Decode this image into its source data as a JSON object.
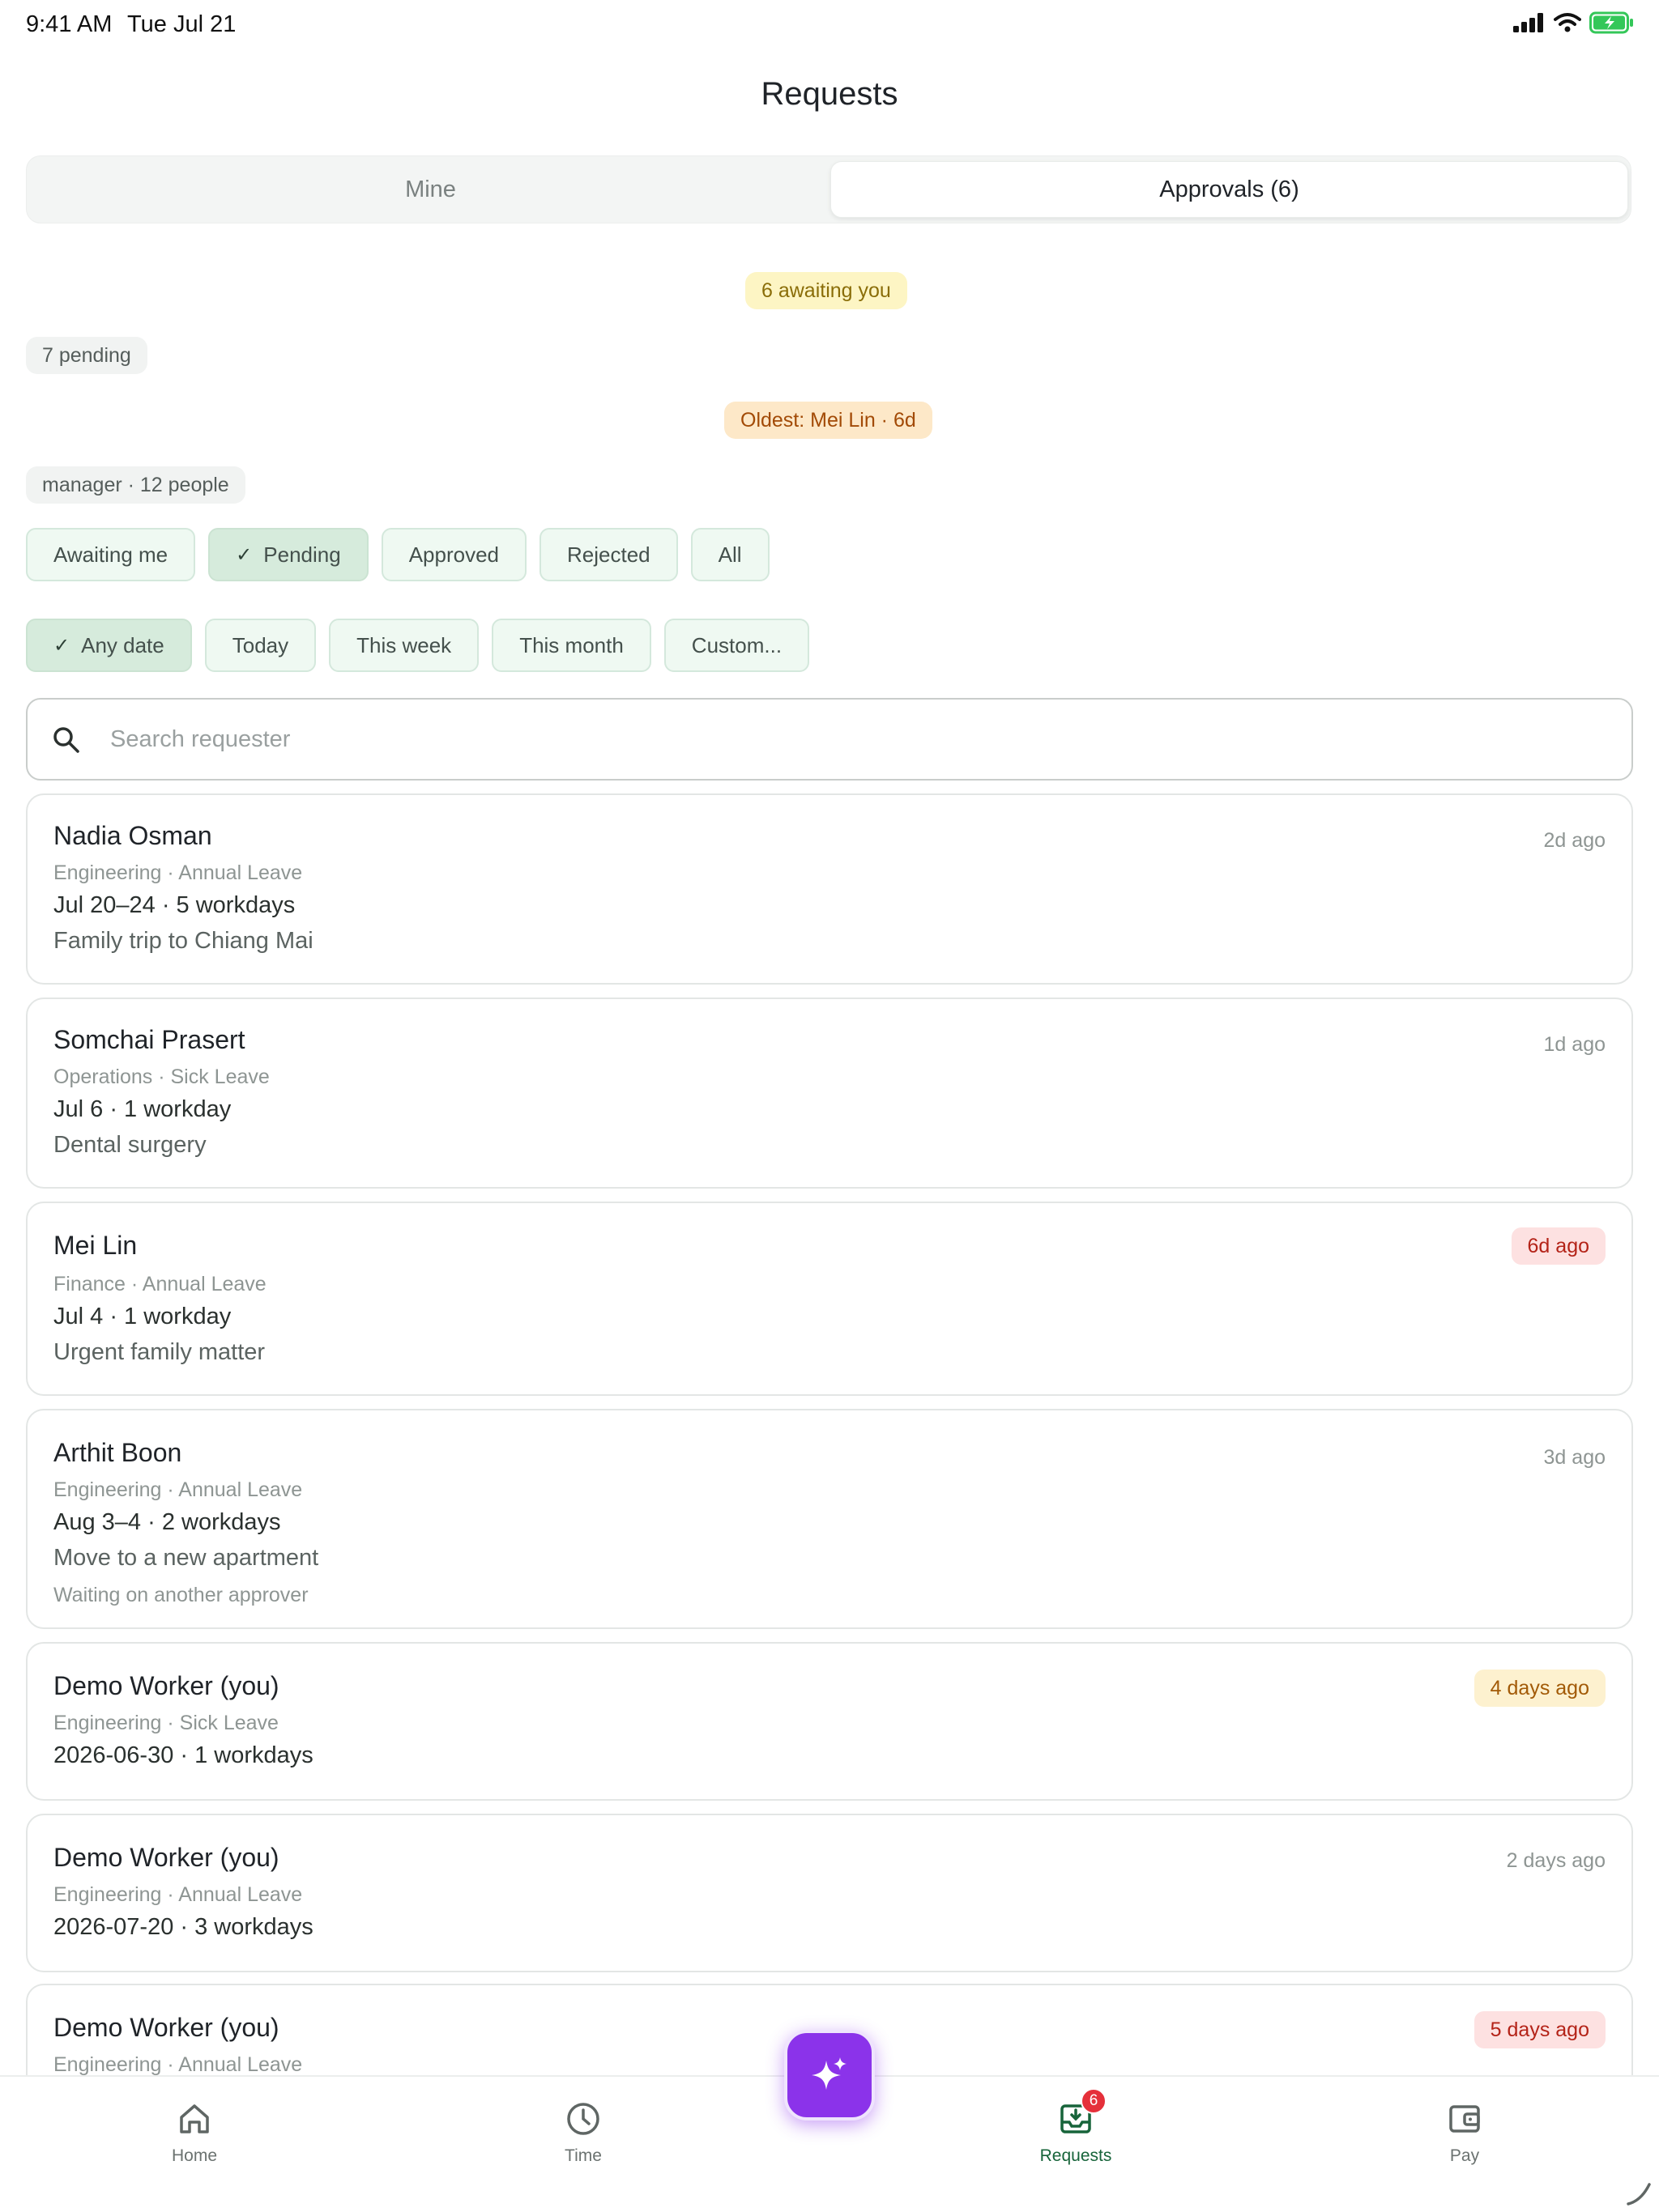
{
  "status_bar": {
    "time": "9:41 AM",
    "date": "Tue Jul 21"
  },
  "header": {
    "title": "Requests"
  },
  "tabs": [
    {
      "label": "Mine",
      "selected": false
    },
    {
      "label": "Approvals (6)",
      "selected": true
    }
  ],
  "summary": {
    "awaiting": "6 awaiting you",
    "pending": "7 pending",
    "oldest": "Oldest: Mei Lin · 6d",
    "scope": "manager · 12 people"
  },
  "status_filters": [
    {
      "label": "Awaiting me",
      "selected": false
    },
    {
      "label": "Pending",
      "selected": true
    },
    {
      "label": "Approved",
      "selected": false
    },
    {
      "label": "Rejected",
      "selected": false
    },
    {
      "label": "All",
      "selected": false
    }
  ],
  "date_filters": [
    {
      "label": "Any date",
      "selected": true
    },
    {
      "label": "Today",
      "selected": false
    },
    {
      "label": "This week",
      "selected": false
    },
    {
      "label": "This month",
      "selected": false
    },
    {
      "label": "Custom...",
      "selected": false
    }
  ],
  "search": {
    "placeholder": "Search requester",
    "value": ""
  },
  "requests": [
    {
      "name": "Nadia Osman",
      "meta": "Engineering · Annual Leave",
      "dates": "Jul 20–24 · 5 workdays",
      "reason": "Family trip to Chiang Mai",
      "note": "",
      "ago": "2d ago",
      "ago_style": "plain"
    },
    {
      "name": "Somchai Prasert",
      "meta": "Operations · Sick Leave",
      "dates": "Jul 6 · 1 workday",
      "reason": "Dental surgery",
      "note": "",
      "ago": "1d ago",
      "ago_style": "plain"
    },
    {
      "name": "Mei Lin",
      "meta": "Finance · Annual Leave",
      "dates": "Jul 4 · 1 workday",
      "reason": "Urgent family matter",
      "note": "",
      "ago": "6d ago",
      "ago_style": "red"
    },
    {
      "name": "Arthit Boon",
      "meta": "Engineering · Annual Leave",
      "dates": "Aug 3–4 · 2 workdays",
      "reason": "Move to a new apartment",
      "note": "Waiting on another approver",
      "ago": "3d ago",
      "ago_style": "plain"
    },
    {
      "name": "Demo Worker (you)",
      "meta": "Engineering · Sick Leave",
      "dates": "2026-06-30 · 1 workdays",
      "reason": "",
      "note": "",
      "ago": "4 days ago",
      "ago_style": "amber"
    },
    {
      "name": "Demo Worker (you)",
      "meta": "Engineering · Annual Leave",
      "dates": "2026-07-20 · 3 workdays",
      "reason": "",
      "note": "",
      "ago": "2 days ago",
      "ago_style": "plain"
    },
    {
      "name": "Demo Worker (you)",
      "meta": "Engineering · Annual Leave",
      "dates": "",
      "reason": "",
      "note": "",
      "ago": "5 days ago",
      "ago_style": "red"
    }
  ],
  "nav": [
    {
      "label": "Home",
      "icon": "home-icon",
      "active": false
    },
    {
      "label": "Time",
      "icon": "clock-icon",
      "active": false
    },
    {
      "label": "Requests",
      "icon": "inbox-icon",
      "active": true,
      "badge": "6"
    },
    {
      "label": "Pay",
      "icon": "wallet-icon",
      "active": false
    }
  ],
  "fab": {
    "icon": "sparkle-icon"
  },
  "colors": {
    "accent": "#17643a",
    "fab": "#8b33ea",
    "chip_bg": "#eff9f2",
    "danger": "#b42318"
  }
}
